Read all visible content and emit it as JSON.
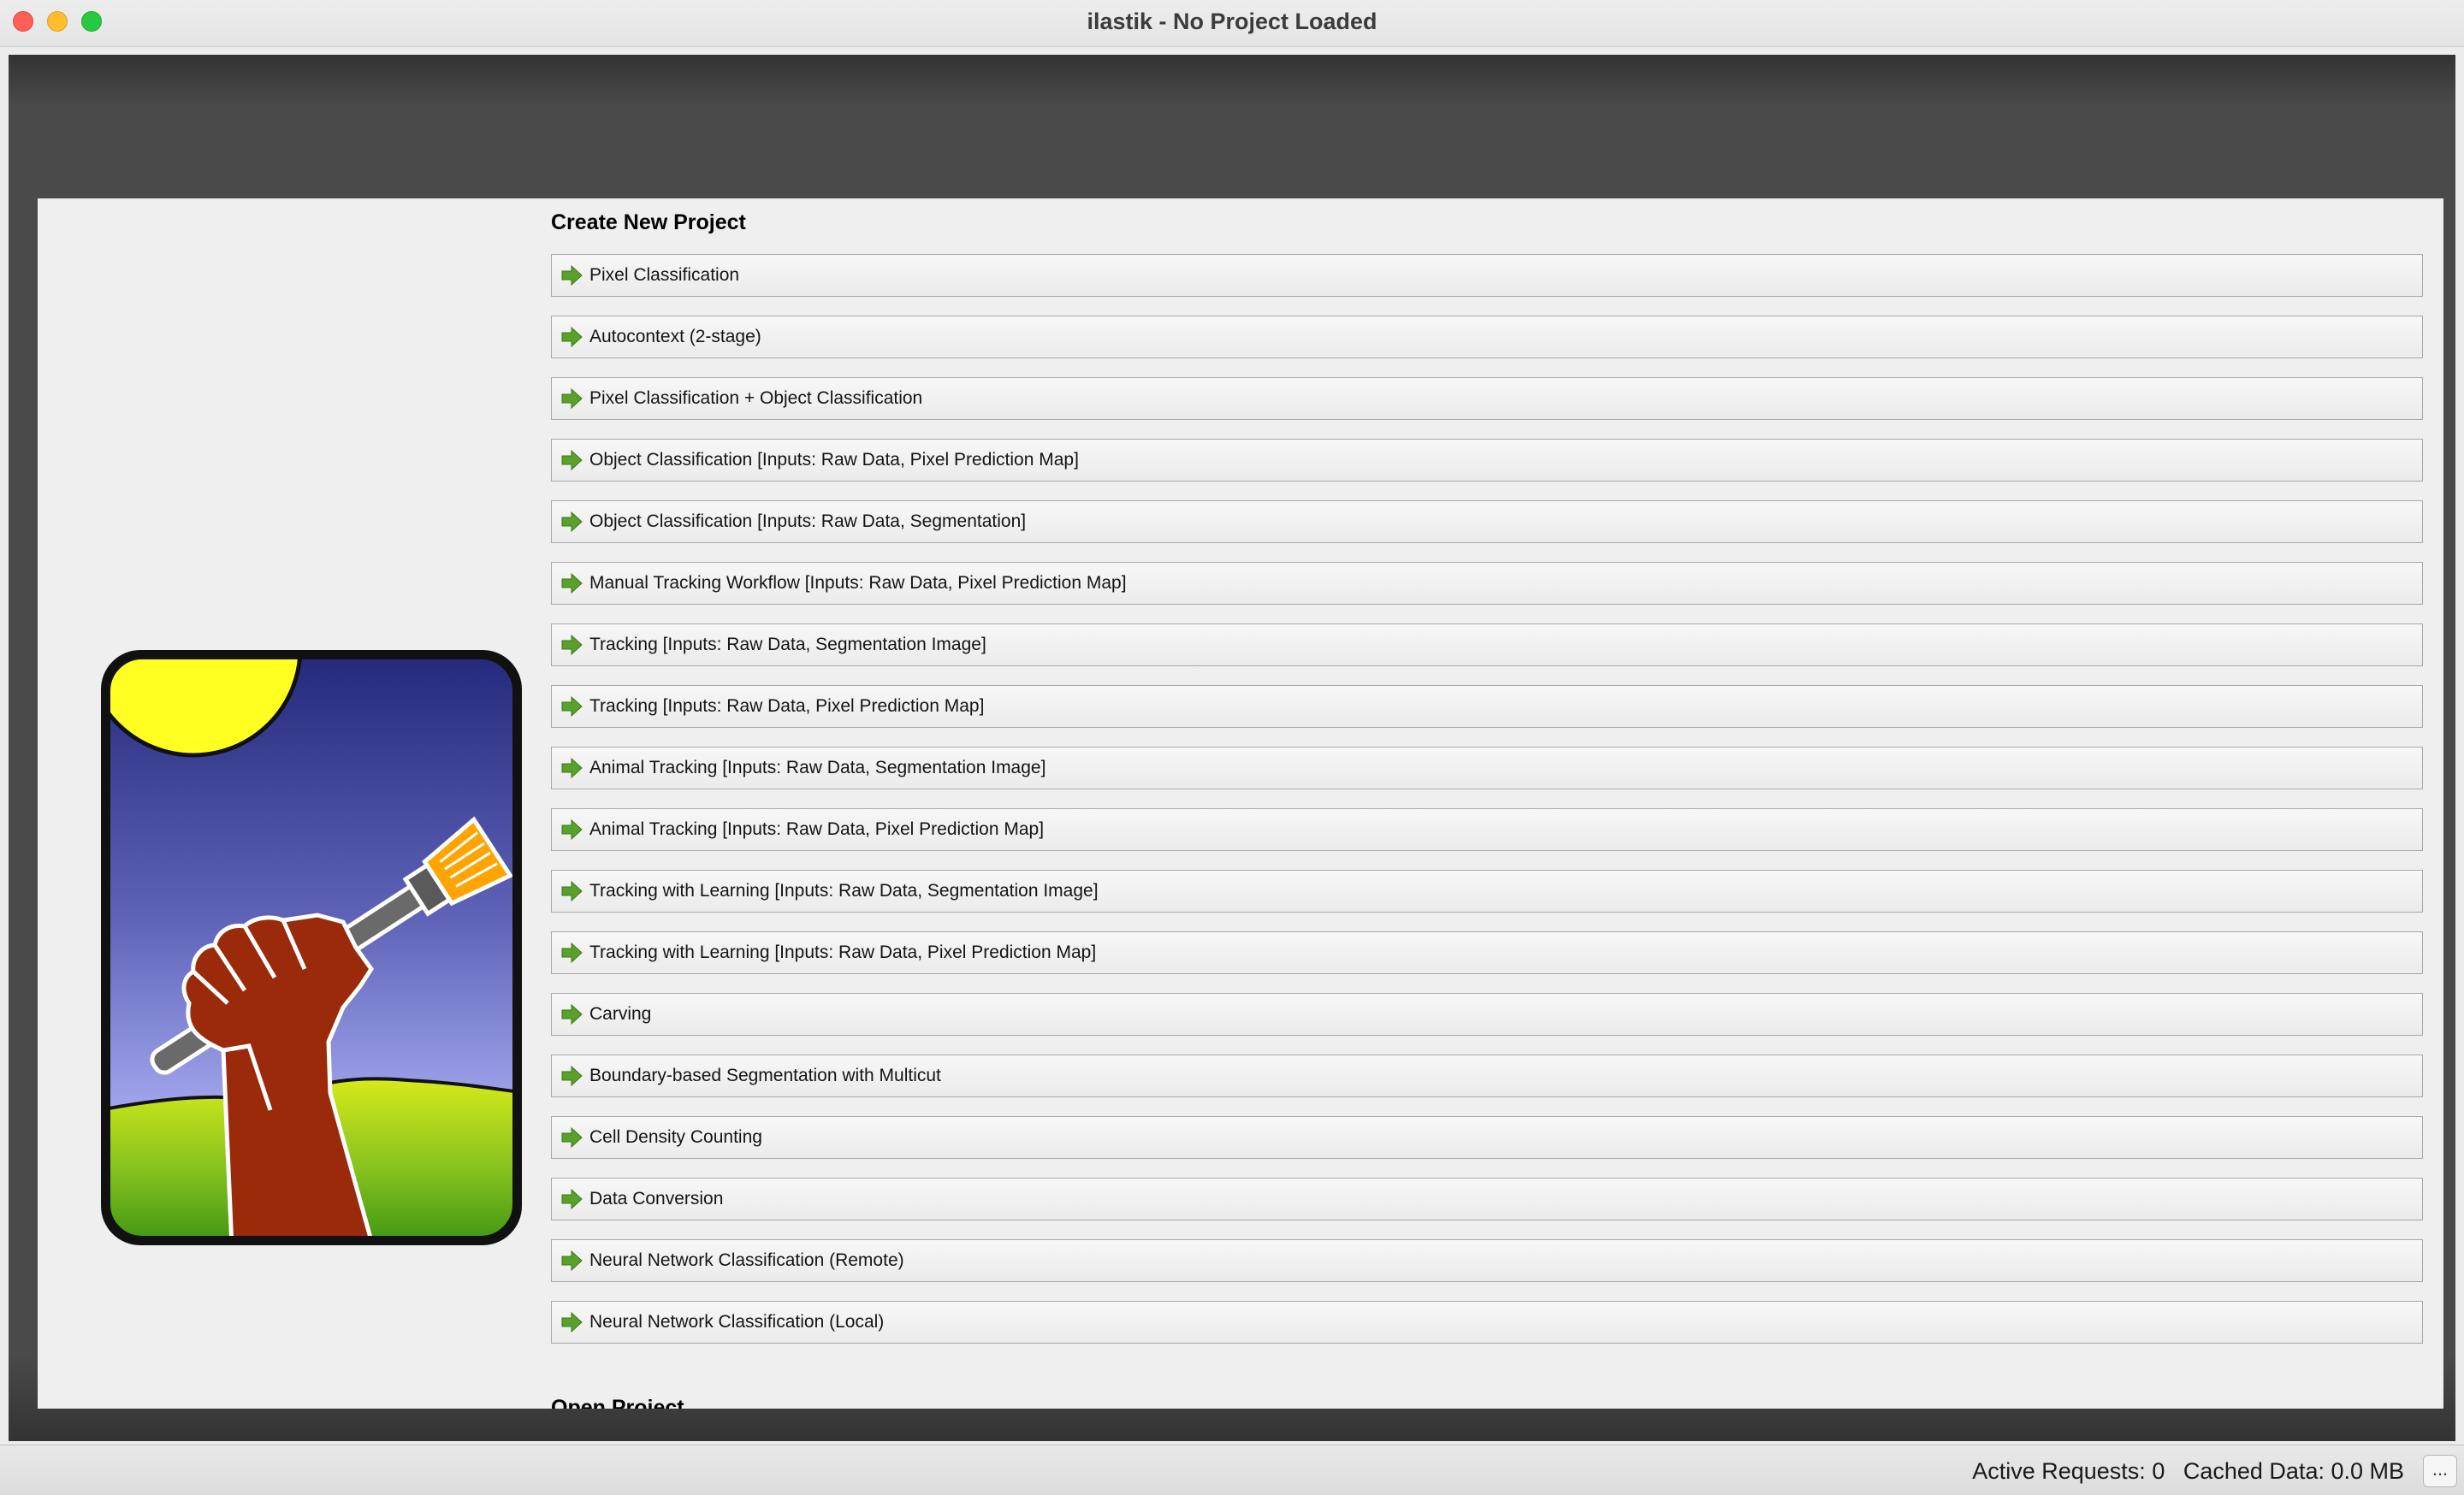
{
  "window": {
    "title": "ilastik - No Project Loaded"
  },
  "start_page": {
    "create_heading": "Create New Project",
    "open_heading": "Open Project",
    "workflows": [
      {
        "label": "Pixel Classification",
        "icon": "green-arrow-icon"
      },
      {
        "label": "Autocontext (2-stage)",
        "icon": "green-arrow-icon"
      },
      {
        "label": "Pixel Classification + Object Classification",
        "icon": "green-arrow-icon"
      },
      {
        "label": "Object Classification [Inputs: Raw Data, Pixel Prediction Map]",
        "icon": "green-arrow-icon"
      },
      {
        "label": "Object Classification [Inputs: Raw Data, Segmentation]",
        "icon": "green-arrow-icon"
      },
      {
        "label": "Manual Tracking Workflow [Inputs: Raw Data, Pixel Prediction Map]",
        "icon": "green-arrow-icon"
      },
      {
        "label": "Tracking [Inputs: Raw Data, Segmentation Image]",
        "icon": "green-arrow-icon"
      },
      {
        "label": "Tracking [Inputs: Raw Data, Pixel Prediction Map]",
        "icon": "green-arrow-icon"
      },
      {
        "label": "Animal Tracking [Inputs: Raw Data, Segmentation Image]",
        "icon": "green-arrow-icon"
      },
      {
        "label": "Animal Tracking [Inputs: Raw Data, Pixel Prediction Map]",
        "icon": "green-arrow-icon"
      },
      {
        "label": "Tracking with Learning [Inputs: Raw Data, Segmentation Image]",
        "icon": "green-arrow-icon"
      },
      {
        "label": "Tracking with Learning [Inputs: Raw Data, Pixel Prediction Map]",
        "icon": "green-arrow-icon"
      },
      {
        "label": "Carving",
        "icon": "green-arrow-icon"
      },
      {
        "label": "Boundary-based Segmentation with Multicut",
        "icon": "green-arrow-icon"
      },
      {
        "label": "Cell Density Counting",
        "icon": "green-arrow-icon"
      },
      {
        "label": "Data Conversion",
        "icon": "green-arrow-icon"
      },
      {
        "label": "Neural Network Classification (Remote)",
        "icon": "green-arrow-icon"
      },
      {
        "label": "Neural Network Classification (Local)",
        "icon": "green-arrow-icon"
      }
    ],
    "logo": "ilastik-fist-paintbrush-logo"
  },
  "status_bar": {
    "active_requests": "Active Requests: 0",
    "cached_data": "Cached Data: 0.0 MB",
    "more_button": "..."
  },
  "colors": {
    "arrow_green": "#5aa02c",
    "frame_dark": "#4a4a4a",
    "page_bg": "#efefef"
  }
}
